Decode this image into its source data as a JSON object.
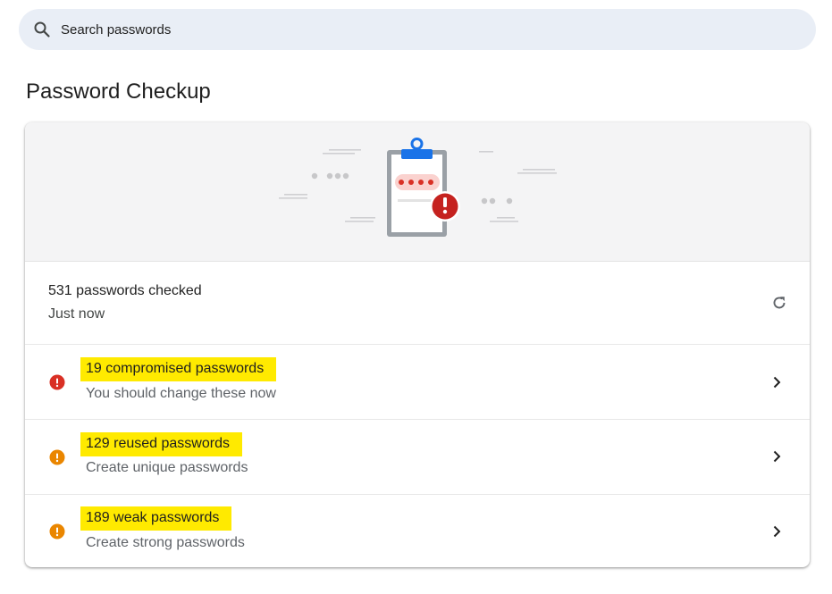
{
  "search": {
    "placeholder": "Search passwords",
    "icon": "search-icon"
  },
  "page": {
    "title": "Password Checkup"
  },
  "summary": {
    "checked_text": "531 passwords checked",
    "time_text": "Just now",
    "refresh_icon": "refresh-icon"
  },
  "issues": [
    {
      "title": "19 compromised passwords",
      "subtitle": "You should change these now",
      "icon": "error-icon",
      "color": "#d93025"
    },
    {
      "title": "129 reused passwords",
      "subtitle": "Create unique passwords",
      "icon": "warning-icon",
      "color": "#ea8600"
    },
    {
      "title": "189 weak passwords",
      "subtitle": "Create strong passwords",
      "icon": "warning-icon",
      "color": "#ea8600"
    }
  ],
  "colors": {
    "highlight": "#ffea00",
    "clipboard_blue": "#1a73e8",
    "alert_red": "#c5221f"
  }
}
